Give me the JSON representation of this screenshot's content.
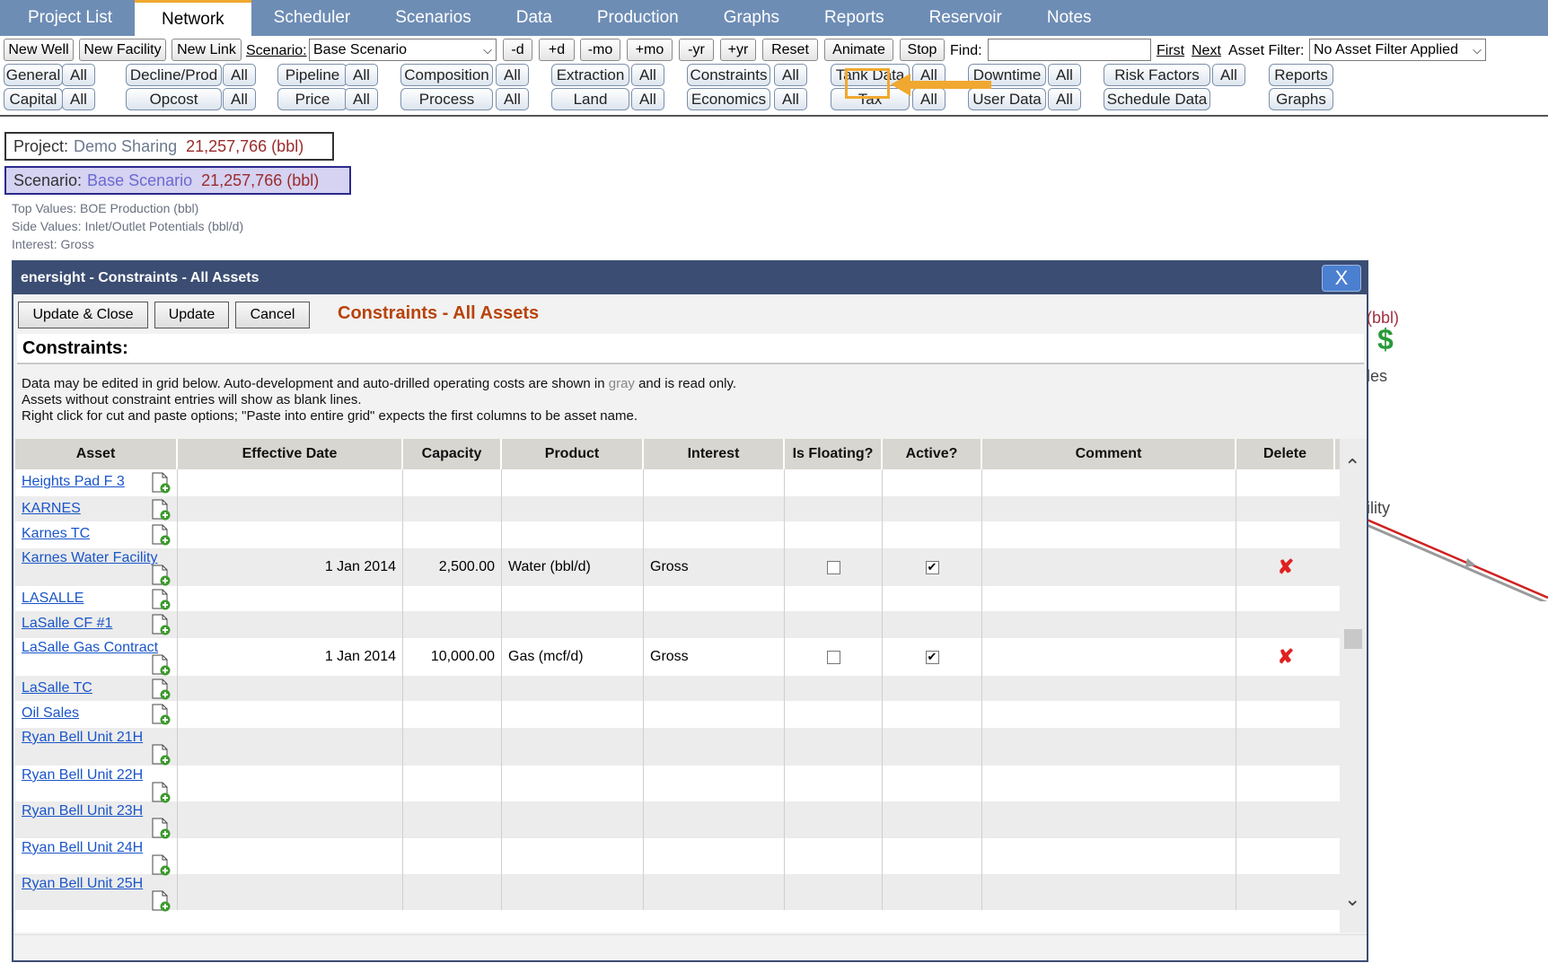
{
  "nav": {
    "tabs": [
      "Project List",
      "Network",
      "Scheduler",
      "Scenarios",
      "Data",
      "Production",
      "Graphs",
      "Reports",
      "Reservoir",
      "Notes"
    ],
    "active_tab": "Network"
  },
  "toolbar": {
    "new_well": "New Well",
    "new_facility": "New Facility",
    "new_link": "New Link",
    "scenario_label": "Scenario:",
    "scenario_value": "Base Scenario",
    "minus_d": "-d",
    "plus_d": "+d",
    "minus_mo": "-mo",
    "plus_mo": "+mo",
    "minus_yr": "-yr",
    "plus_yr": "+yr",
    "reset": "Reset",
    "animate": "Animate",
    "stop": "Stop",
    "find_label": "Find:",
    "find_value": "",
    "first": "First",
    "next": "Next",
    "asset_filter_label": "Asset Filter:",
    "asset_filter_value": "No Asset Filter Applied"
  },
  "categories": {
    "all_label": "All",
    "row1": [
      "General",
      "Decline/Prod",
      "Pipeline",
      "Composition",
      "Extraction",
      "Constraints",
      "Tank Data",
      "Downtime",
      "Risk Factors",
      "Reports"
    ],
    "row2": [
      "Capital",
      "Opcost",
      "Price",
      "Process",
      "Land",
      "Economics",
      "Tax",
      "User Data",
      "Schedule Data",
      "Graphs"
    ]
  },
  "project": {
    "label": "Project:",
    "name": "Demo Sharing",
    "value": "21,257,766 (bbl)"
  },
  "scenario": {
    "label": "Scenario:",
    "name": "Base Scenario",
    "value": "21,257,766 (bbl)"
  },
  "meta": {
    "top_values": "Top Values: BOE Production (bbl)",
    "side_values": "Side Values: Inlet/Outlet Potentials (bbl/d)",
    "interest": "Interest: Gross"
  },
  "background": {
    "bbl": "(bbl)",
    "dollar": "$",
    "les": "les",
    "ility": "ility"
  },
  "dialog": {
    "title": "enersight - Constraints - All Assets",
    "close": "X",
    "update_close": "Update & Close",
    "update": "Update",
    "cancel": "Cancel",
    "heading": "Constraints - All Assets",
    "section": "Constraints:",
    "instr_1a": "Data may be edited in grid below. Auto-development and auto-drilled operating costs are shown in ",
    "instr_1b": "gray",
    "instr_1c": " and is read only.",
    "instr_2": "Assets without constraint entries will show as blank lines.",
    "instr_3": "Right click for cut and paste options; \"Paste into entire grid\" expects the first columns to be asset name."
  },
  "grid": {
    "columns": [
      "Asset",
      "Effective Date",
      "Capacity",
      "Product",
      "Interest",
      "Is Floating?",
      "Active?",
      "Comment",
      "Delete"
    ],
    "rows": [
      {
        "asset": "Heights Pad F 3",
        "date": "",
        "capacity": "",
        "product": "",
        "interest": "",
        "floating": null,
        "active": null,
        "deletable": false
      },
      {
        "asset": "KARNES",
        "date": "",
        "capacity": "",
        "product": "",
        "interest": "",
        "floating": null,
        "active": null,
        "deletable": false
      },
      {
        "asset": "Karnes TC",
        "date": "",
        "capacity": "",
        "product": "",
        "interest": "",
        "floating": null,
        "active": null,
        "deletable": false
      },
      {
        "asset": "Karnes Water Facility",
        "date": "1 Jan 2014",
        "capacity": "2,500.00",
        "product": "Water (bbl/d)",
        "interest": "Gross",
        "floating": false,
        "active": true,
        "deletable": true
      },
      {
        "asset": "LASALLE",
        "date": "",
        "capacity": "",
        "product": "",
        "interest": "",
        "floating": null,
        "active": null,
        "deletable": false
      },
      {
        "asset": "LaSalle CF #1",
        "date": "",
        "capacity": "",
        "product": "",
        "interest": "",
        "floating": null,
        "active": null,
        "deletable": false
      },
      {
        "asset": "LaSalle Gas Contract",
        "date": "1 Jan 2014",
        "capacity": "10,000.00",
        "product": "Gas (mcf/d)",
        "interest": "Gross",
        "floating": false,
        "active": true,
        "deletable": true
      },
      {
        "asset": "LaSalle TC",
        "date": "",
        "capacity": "",
        "product": "",
        "interest": "",
        "floating": null,
        "active": null,
        "deletable": false
      },
      {
        "asset": "Oil Sales",
        "date": "",
        "capacity": "",
        "product": "",
        "interest": "",
        "floating": null,
        "active": null,
        "deletable": false
      },
      {
        "asset": "Ryan Bell Unit 21H",
        "date": "",
        "capacity": "",
        "product": "",
        "interest": "",
        "floating": null,
        "active": null,
        "deletable": false
      },
      {
        "asset": "Ryan Bell Unit 22H",
        "date": "",
        "capacity": "",
        "product": "",
        "interest": "",
        "floating": null,
        "active": null,
        "deletable": false
      },
      {
        "asset": "Ryan Bell Unit 23H",
        "date": "",
        "capacity": "",
        "product": "",
        "interest": "",
        "floating": null,
        "active": null,
        "deletable": false
      },
      {
        "asset": "Ryan Bell Unit 24H",
        "date": "",
        "capacity": "",
        "product": "",
        "interest": "",
        "floating": null,
        "active": null,
        "deletable": false
      },
      {
        "asset": "Ryan Bell Unit 25H",
        "date": "",
        "capacity": "",
        "product": "",
        "interest": "",
        "floating": null,
        "active": null,
        "deletable": false
      }
    ]
  },
  "colors": {
    "nav_bg": "#6e8db5",
    "dialog_title_bg": "#3b4d72",
    "heading": "#b8430a",
    "link": "#1a55c9",
    "highlight": "#f0a830"
  }
}
